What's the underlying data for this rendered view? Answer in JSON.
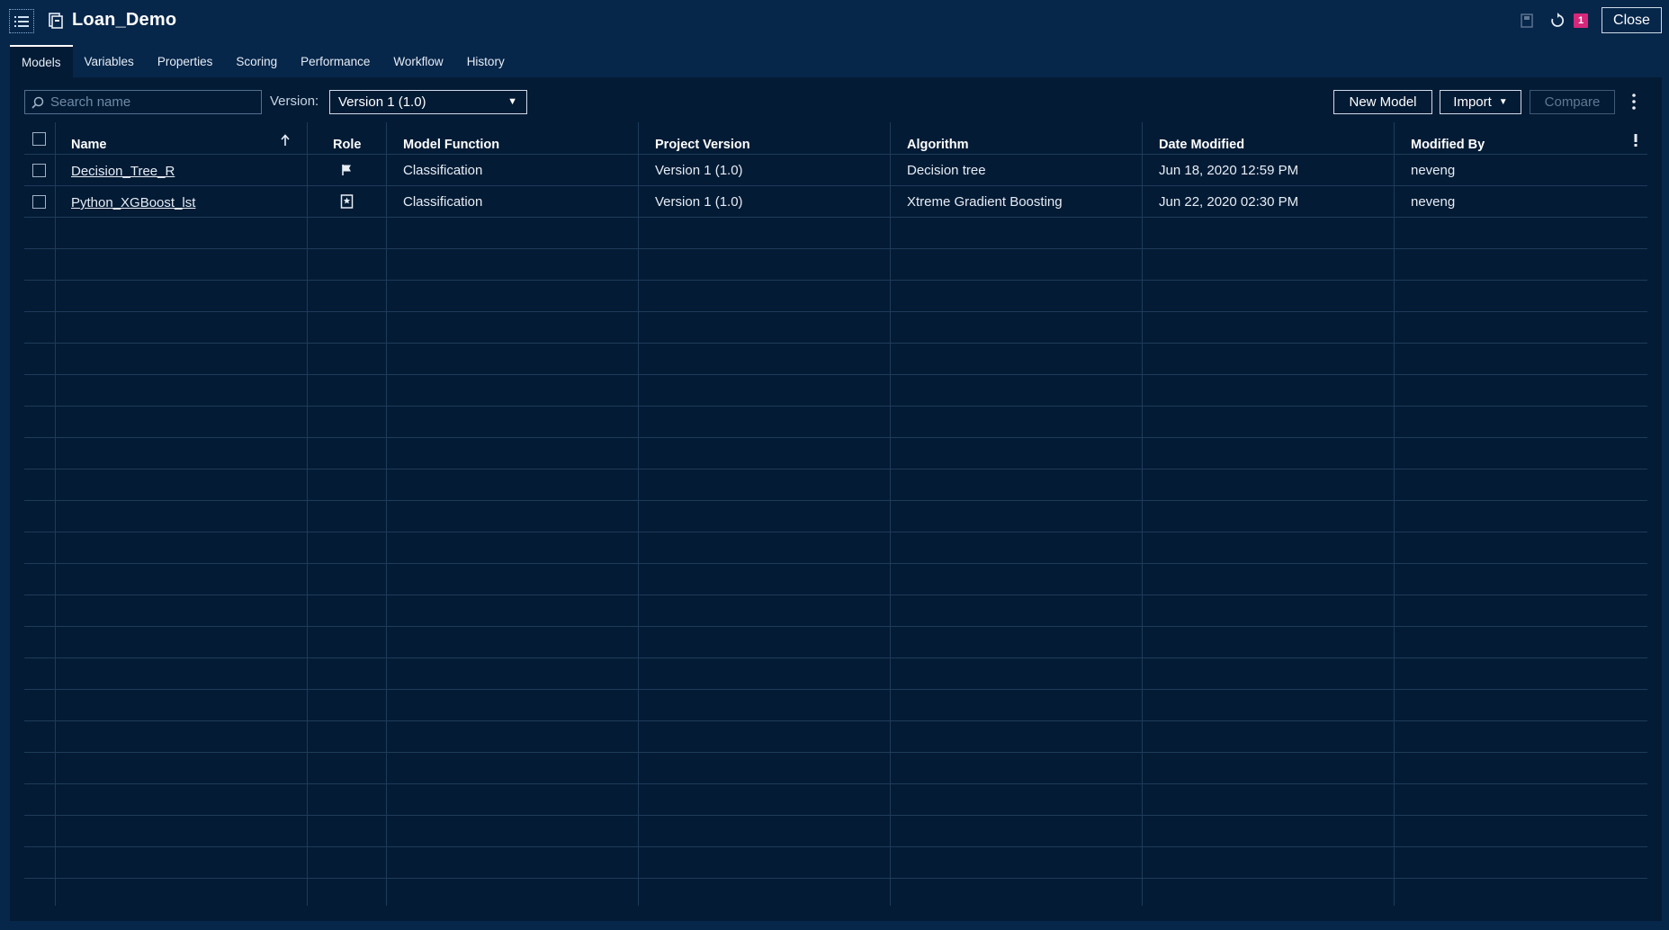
{
  "app": {
    "title": "Loan_Demo",
    "close_label": "Close",
    "notification_count": "1"
  },
  "tabs": [
    {
      "label": "Models",
      "active": true
    },
    {
      "label": "Variables"
    },
    {
      "label": "Properties"
    },
    {
      "label": "Scoring"
    },
    {
      "label": "Performance"
    },
    {
      "label": "Workflow"
    },
    {
      "label": "History"
    }
  ],
  "toolbar": {
    "search_placeholder": "Search name",
    "version_label": "Version:",
    "version_value": "Version 1 (1.0)",
    "new_model_label": "New Model",
    "import_label": "Import",
    "compare_label": "Compare"
  },
  "table": {
    "columns": {
      "name": "Name",
      "role": "Role",
      "model_function": "Model Function",
      "project_version": "Project Version",
      "algorithm": "Algorithm",
      "date_modified": "Date Modified",
      "modified_by": "Modified By"
    },
    "rows": [
      {
        "name": "Decision_Tree_R",
        "role_icon": "flag-icon",
        "model_function": "Classification",
        "project_version": "Version 1 (1.0)",
        "algorithm": "Decision tree",
        "date_modified": "Jun 18, 2020 12:59 PM",
        "modified_by": "neveng"
      },
      {
        "name": "Python_XGBoost_lst",
        "role_icon": "champion-bookmark-icon",
        "model_function": "Classification",
        "project_version": "Version 1 (1.0)",
        "algorithm": "Xtreme Gradient Boosting",
        "date_modified": "Jun 22, 2020 02:30 PM",
        "modified_by": "neveng"
      }
    ]
  },
  "colors": {
    "background": "#06264a",
    "panel": "#041b35",
    "badge": "#d6287a",
    "gridline": "#1e3b59"
  }
}
